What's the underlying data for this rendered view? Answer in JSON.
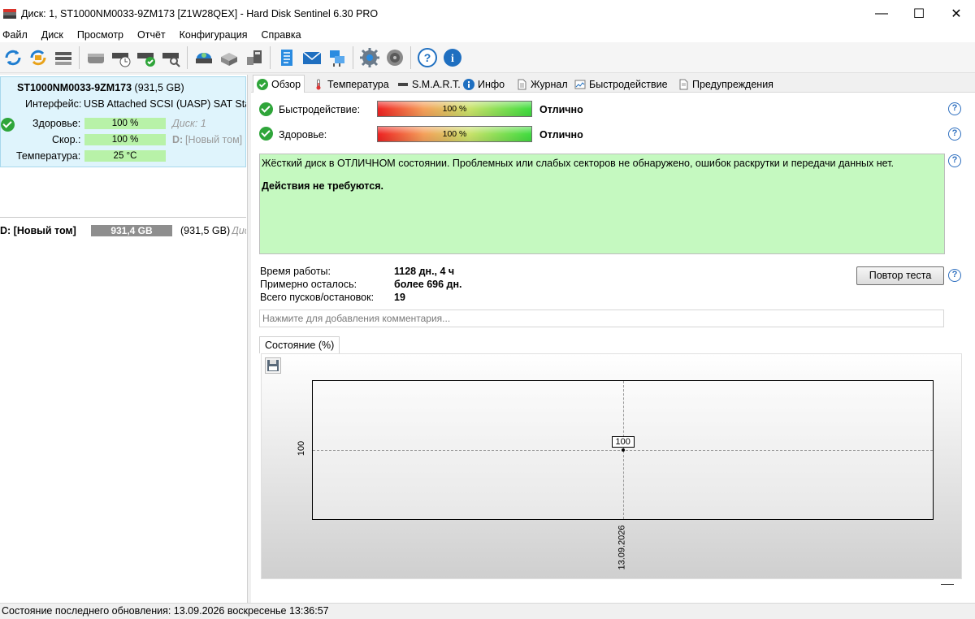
{
  "window": {
    "title": "Диск: 1, ST1000NM0033-9ZM173 [Z1W28QEX]  -  Hard Disk Sentinel 6.30 PRO",
    "minimize": "—",
    "maximize": "☐",
    "close": "✕"
  },
  "menu": [
    "Файл",
    "Диск",
    "Просмотр",
    "Отчёт",
    "Конфигурация",
    "Справка"
  ],
  "toolbar": {
    "icons": [
      "refresh-icon",
      "refresh-all-icon",
      "disk-list-icon",
      "disk-gray-icon",
      "disk-schedule-icon",
      "disk-check-icon",
      "disk-search-icon",
      "disk-test-icon",
      "disk-eject-icon",
      "disk-usb-icon",
      "report-icon",
      "email-icon",
      "network-icon",
      "settings-icon",
      "sound-icon",
      "help-icon",
      "info-icon"
    ]
  },
  "disk": {
    "name": "ST1000NM0033-9ZM173",
    "size": "(931,5 GB)",
    "interface_label": "Интерфейс:",
    "interface_value": "USB Attached SCSI (UASP) SAT Stand",
    "health_label": "Здоровье:",
    "health_value": "100 %",
    "health_note": "Диск: 1",
    "perf_label": "Скор.:",
    "perf_value": "100 %",
    "perf_note_drive": "D:",
    "perf_note_vol": "[Новый том]",
    "temp_label": "Температура:",
    "temp_value": "25 °C"
  },
  "volume": {
    "name": "D: [Новый том]",
    "free": "931,4 GB",
    "total": "(931,5 GB)",
    "disk_note": "Дис"
  },
  "tabs": [
    "Обзор",
    "Температура",
    "S.M.A.R.T.",
    "Инфо",
    "Журнал",
    "Быстродействие",
    "Предупреждения"
  ],
  "overview": {
    "perf_label": "Быстродействие:",
    "perf_value": "100 %",
    "perf_rating": "Отлично",
    "perf_fraction": 1.0,
    "health_label": "Здоровье:",
    "health_value": "100 %",
    "health_rating": "Отлично",
    "health_fraction": 1.0,
    "message": "Жёсткий диск в ОТЛИЧНОМ состоянии. Проблемных или слабых секторов не обнаружено, ошибок раскрутки и передачи данных нет.",
    "action": "Действия не требуются.",
    "uptime_label": "Время работы:",
    "uptime_value": "1128 дн., 4 ч",
    "remaining_label": "Примерно осталось:",
    "remaining_value": "более 696 дн.",
    "starts_label": "Всего пусков/остановок:",
    "starts_value": "19",
    "retest_button": "Повтор теста",
    "comment_placeholder": "Нажмите для добавления комментария...",
    "chart_tab": "Состояние (%)",
    "help": "?"
  },
  "chart_data": {
    "type": "line",
    "x": [
      "13.09.2026"
    ],
    "series": [
      {
        "values": [
          100
        ]
      }
    ],
    "y_tick_labels": [
      "100"
    ],
    "data_labels": [
      "100"
    ],
    "grid": true
  },
  "statusbar": {
    "text": "Состояние последнего обновления: 13.09.2026 воскресенье 13:36:57"
  }
}
